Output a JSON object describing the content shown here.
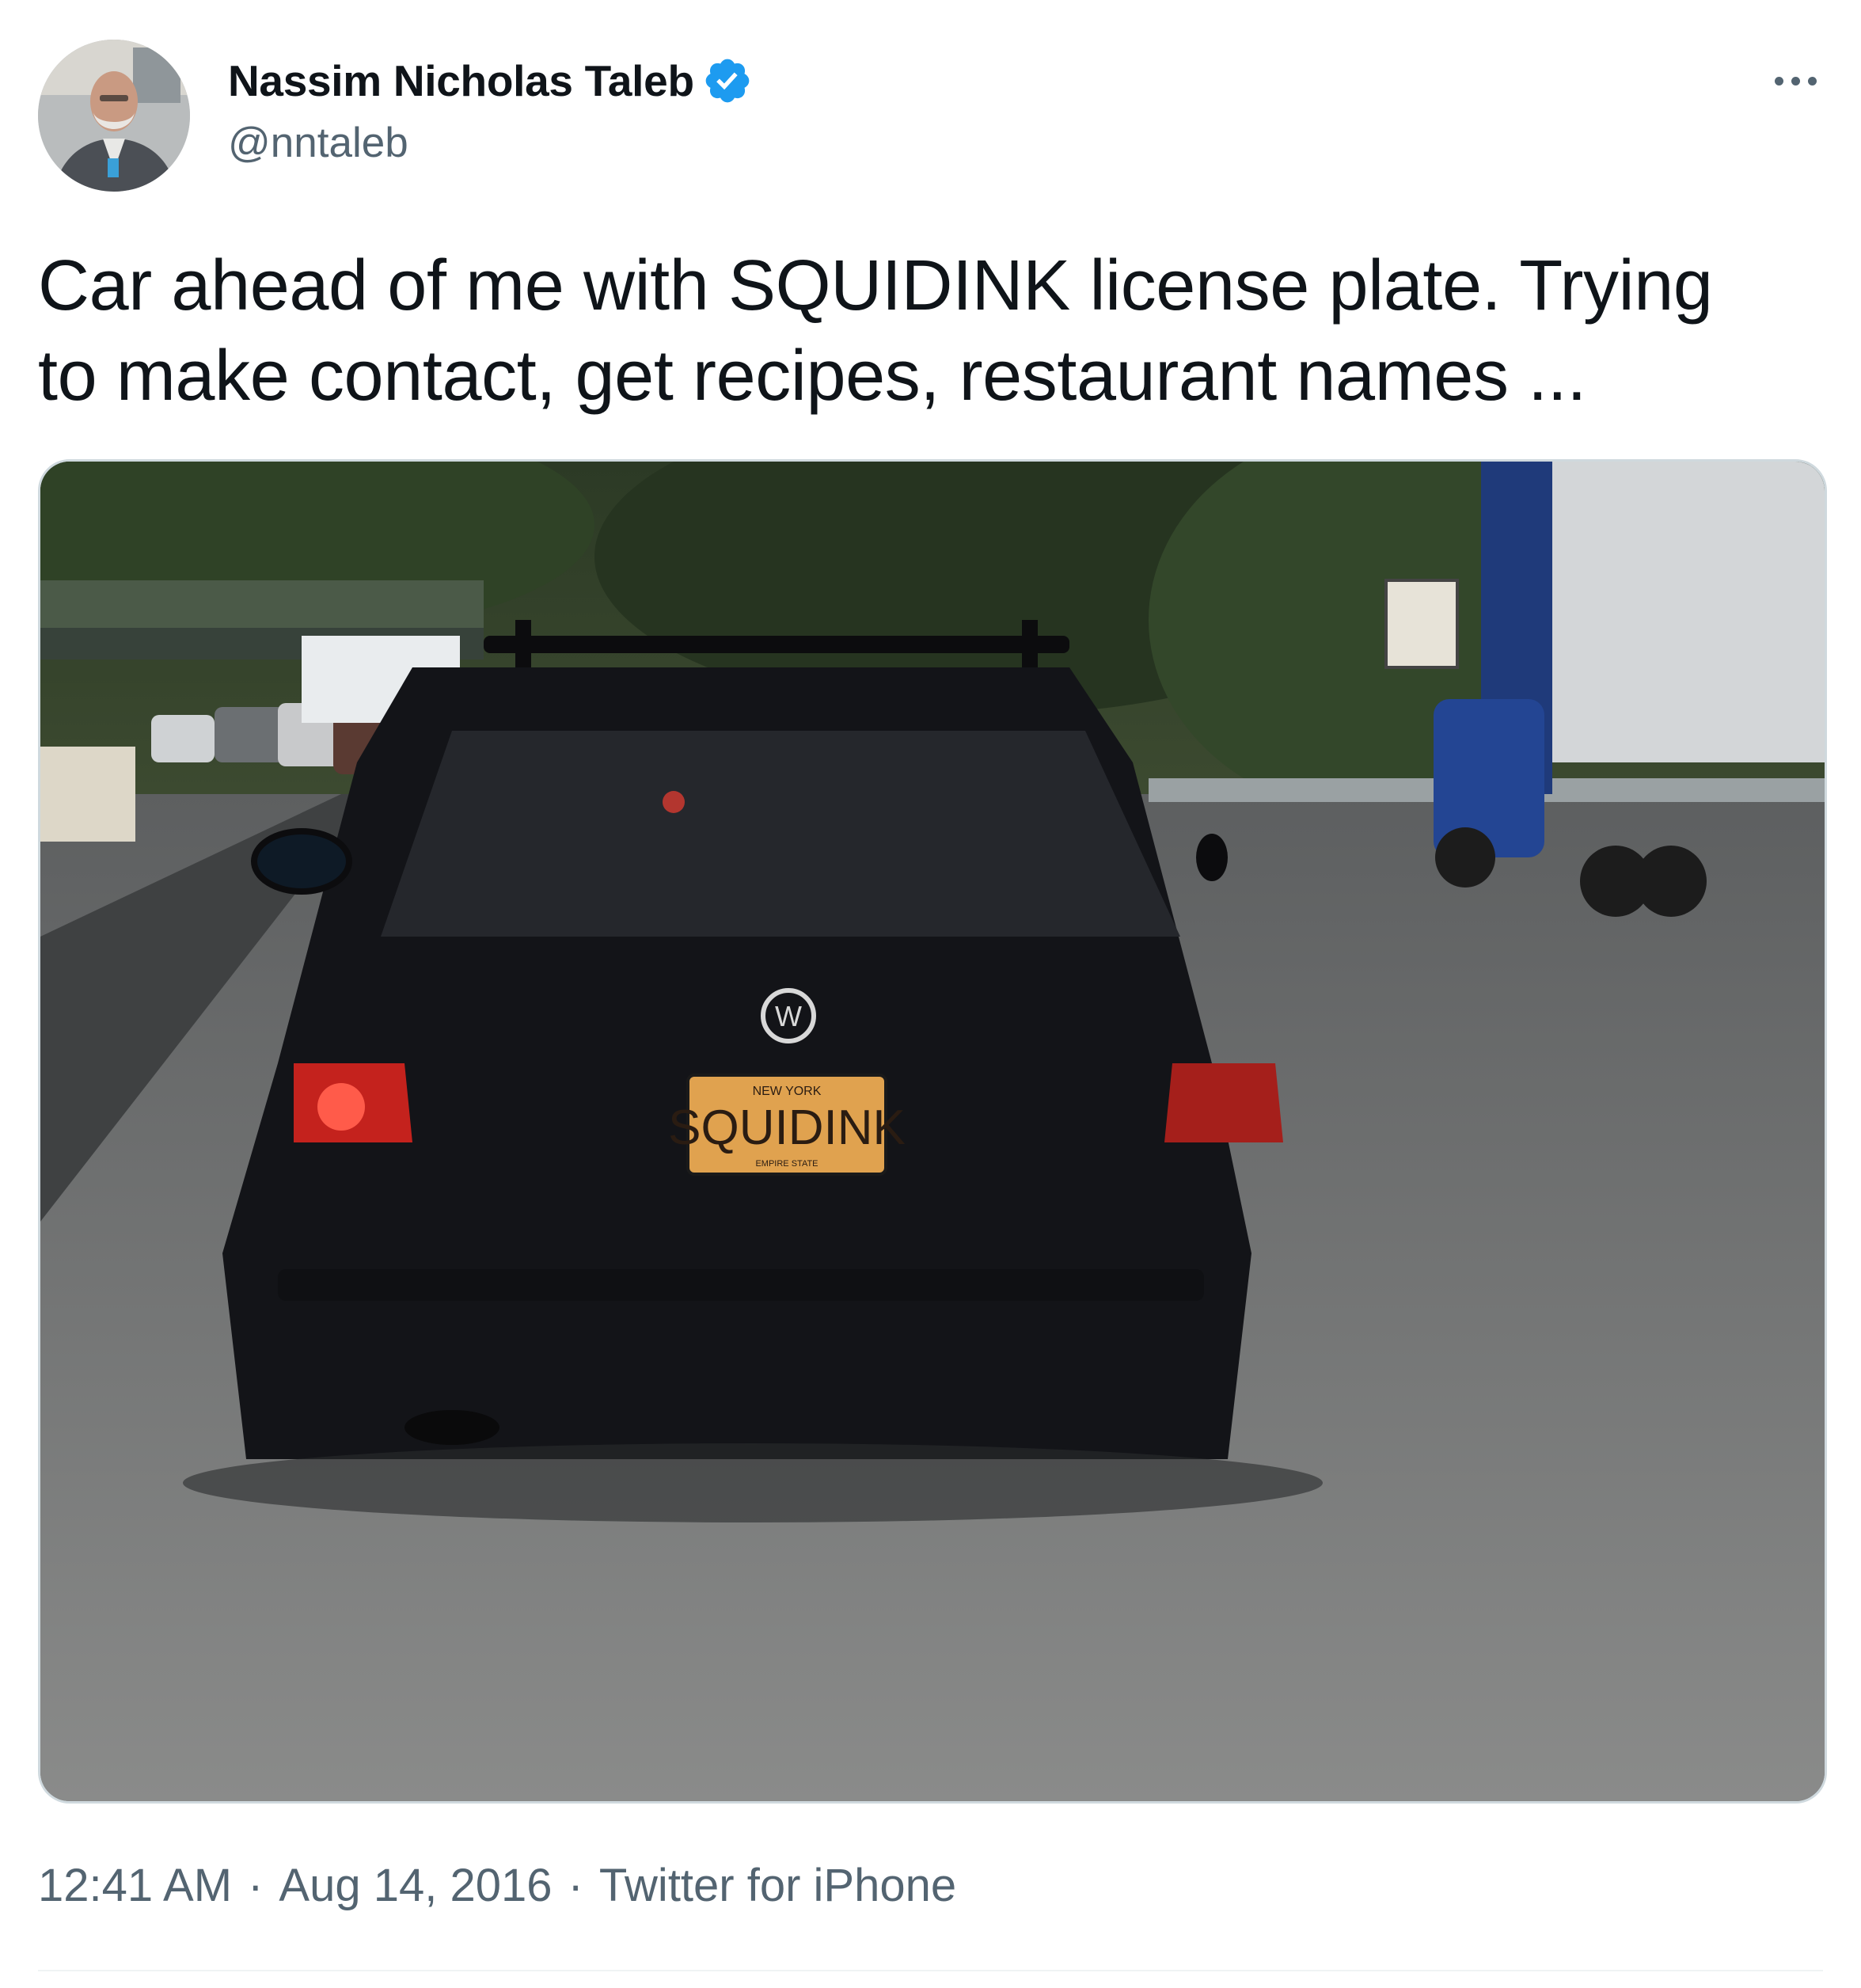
{
  "author": {
    "display_name": "Nassim Nicholas Taleb",
    "handle": "@nntaleb",
    "verified": true,
    "avatar_icon": "profile-photo"
  },
  "tweet": {
    "text": "Car ahead of me with SQUIDINK license plate. Trying\nto make contact, get recipes, restaurant names ...",
    "media": {
      "plate_state": "NEW YORK",
      "plate_text": "SQUIDINK",
      "plate_footer": "EMPIRE STATE"
    }
  },
  "meta": {
    "time": "12:41 AM",
    "date": "Aug 14, 2016",
    "source": "Twitter for iPhone",
    "separator": "·"
  },
  "icons": {
    "more": "more-horizontal-icon",
    "verified": "verified-badge-icon"
  },
  "colors": {
    "verified_blue": "#1d9bf0",
    "secondary_text": "#536471",
    "primary_text": "#0f1419"
  }
}
